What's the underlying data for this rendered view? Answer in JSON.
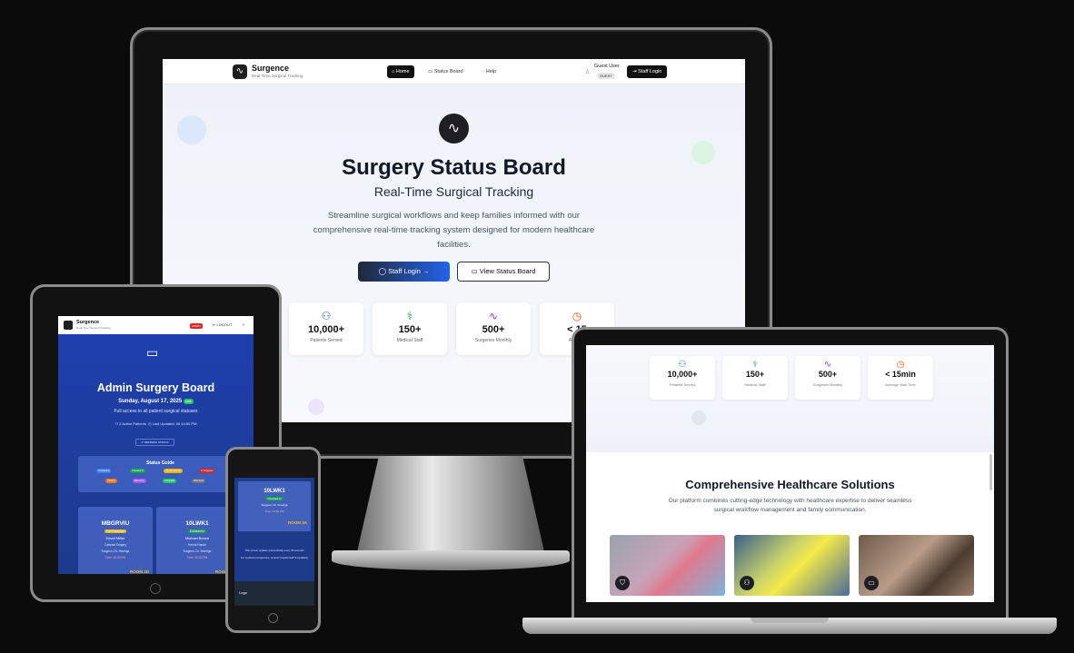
{
  "desktop": {
    "nav": {
      "brand": "Surgence",
      "brand_sub": "Real-Time Surgical Tracking",
      "home": "Home",
      "status_board": "Status Board",
      "help": "Help",
      "guest": "Guest User",
      "guest_badge": "GUEST",
      "staff_login": "Staff Login"
    },
    "hero": {
      "title": "Surgery Status Board",
      "subtitle": "Real-Time Surgical Tracking",
      "description": "Streamline surgical workflows and keep families informed with our comprehensive real-time tracking system designed for modern healthcare facilities.",
      "primary_button": "Staff Login",
      "secondary_button": "View Status Board"
    },
    "stats": [
      {
        "value": "10,000+",
        "label": "Patients Served",
        "color": "#2563eb"
      },
      {
        "value": "150+",
        "label": "Medical Staff",
        "color": "#16a34a"
      },
      {
        "value": "500+",
        "label": "Surgeries Monthly",
        "color": "#9333ea"
      },
      {
        "value": "< 15",
        "label": "Average",
        "color": "#ea580c"
      }
    ]
  },
  "tablet": {
    "brand": "Surgence",
    "brand_sub": "Real-Time Surgical Tracking",
    "badge": "ADMIN",
    "logout": "LOGOUT",
    "title": "Admin Surgery Board",
    "date": "Sunday, August 17, 2025",
    "live": "Live",
    "access": "Full access to all patient surgical statuses",
    "active": "2 Active Patients",
    "updated": "Last Updated: 00:16:50 PM",
    "refresh": "REFRESH STATUS",
    "guide_title": "Status Guide",
    "statuses": [
      {
        "label": "Scheduled",
        "color": "#3b82f6"
      },
      {
        "label": "Checked In",
        "color": "#16a34a"
      },
      {
        "label": "Pre-Procedure",
        "color": "#eab308"
      },
      {
        "label": "In Progress",
        "color": "#dc2626"
      },
      {
        "label": "Closing",
        "color": "#f97316"
      },
      {
        "label": "Recovery",
        "color": "#a855f7"
      },
      {
        "label": "Complete",
        "color": "#22c55e"
      },
      {
        "label": "Dismissal",
        "color": "#6b7280"
      }
    ],
    "cards": [
      {
        "id": "MBGRVIU",
        "status": "Pre-Procedure",
        "name": "David Miller",
        "procedure": "Cataract Surgery",
        "surgeon": "Surgeon: Dr. Smeriga",
        "time": "Time: 10:30 PM",
        "room": "ROOM 2D"
      },
      {
        "id": "10LWK1",
        "status": "Checked In",
        "name": "Michael Brown",
        "procedure": "Hernia Repair",
        "surgeon": "Surgeon: Dr. Smeriga",
        "time": "Time: 10:00 PM",
        "room": "ROOM 3A"
      }
    ]
  },
  "phone": {
    "id": "10LWK1",
    "status": "Checked In",
    "surgeon": "Surgeon: Dr. Smeriga",
    "time": "Time: 10:00 PM",
    "room": "ROOM 3A",
    "note": "This screen updates automatically every 30 seconds",
    "note2": "For medical emergencies, contact hospital staff immediately",
    "footer_logo": "Logo"
  },
  "laptop": {
    "stats": [
      {
        "value": "10,000+",
        "label": "Patients Served",
        "color": "#2563eb"
      },
      {
        "value": "150+",
        "label": "Medical Staff",
        "color": "#16a34a"
      },
      {
        "value": "500+",
        "label": "Surgeries Monthly",
        "color": "#9333ea"
      },
      {
        "value": "< 15min",
        "label": "Average Wait Time",
        "color": "#ea580c"
      }
    ],
    "heading": "Comprehensive Healthcare Solutions",
    "description": "Our platform combines cutting-edge technology with healthcare expertise to deliver seamless surgical workflow management and family communication.",
    "images": [
      {
        "name": "nhs-heart-image",
        "icon": "shield-icon"
      },
      {
        "name": "ambulance-image",
        "icon": "users-icon"
      },
      {
        "name": "family-care-image",
        "icon": "monitor-icon"
      }
    ]
  }
}
